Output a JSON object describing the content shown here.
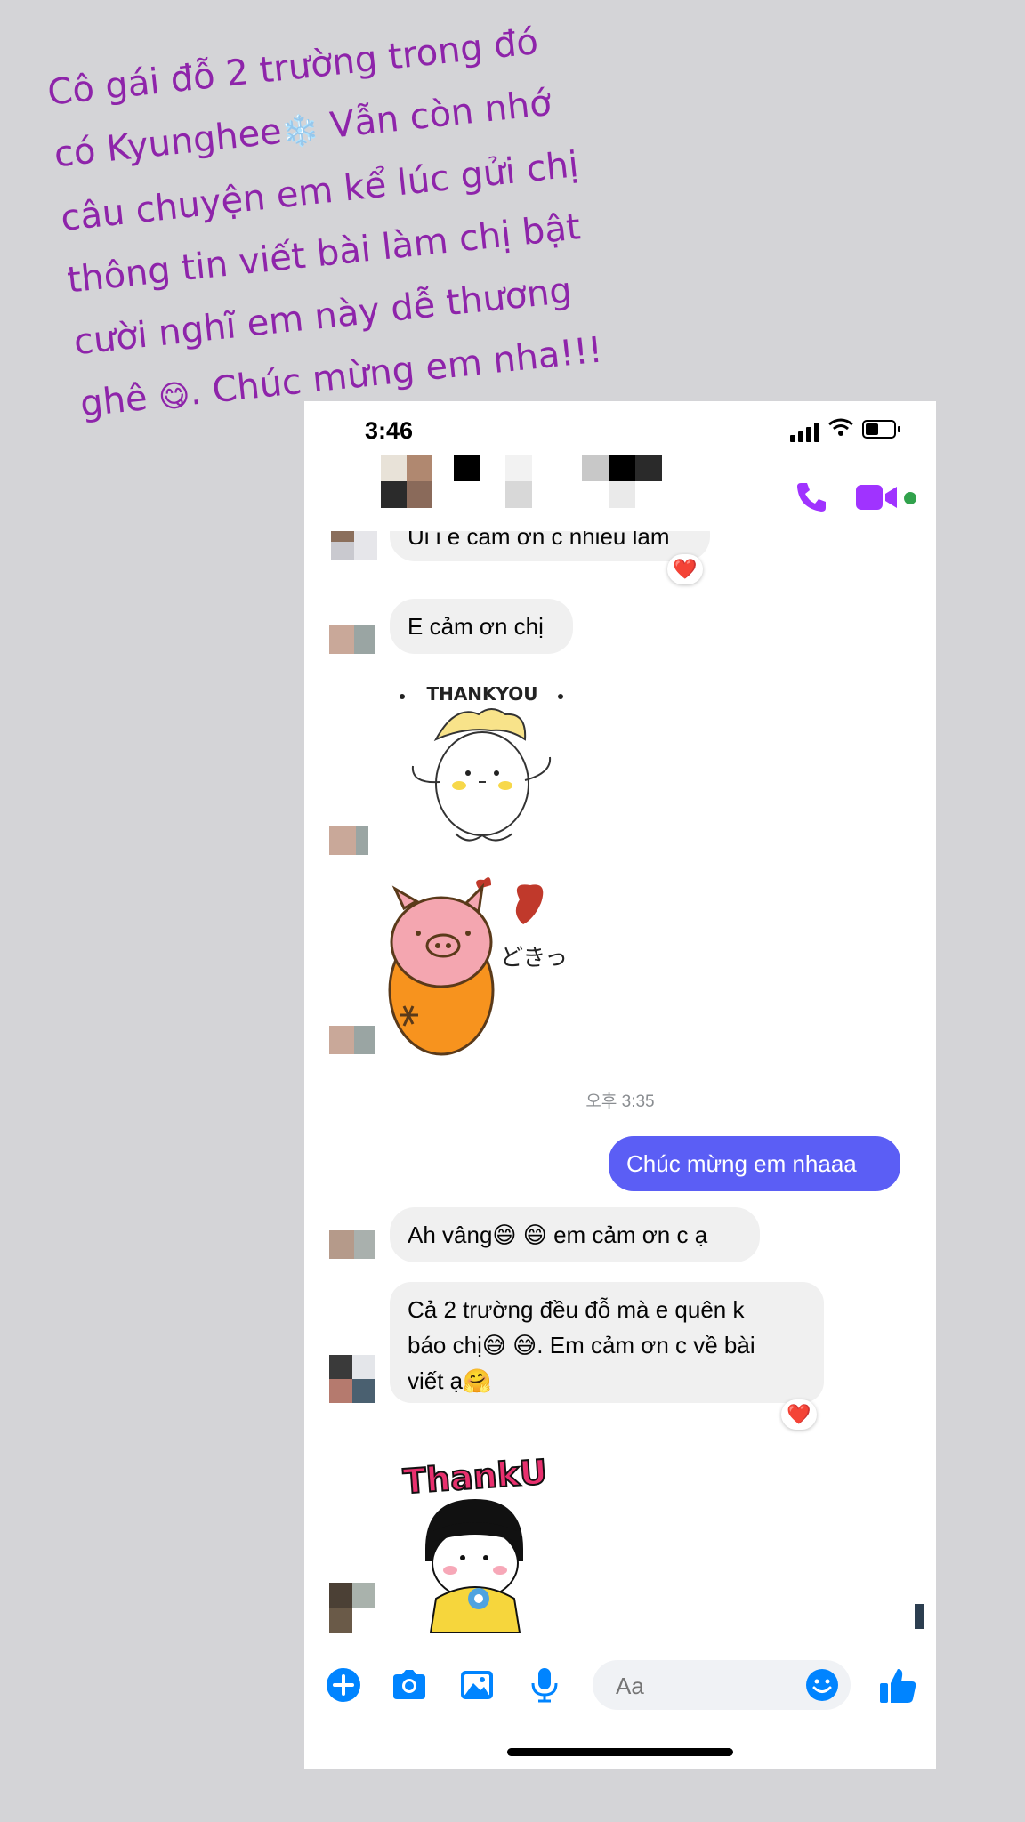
{
  "story": {
    "caption_lines": [
      "Cô gái đỗ 2 trường trong đó",
      "có Kyunghee",
      "❄️",
      " Vẫn còn nhớ",
      "câu chuyện em kể lúc gửi chị",
      "thông tin viết bài làm chị bật",
      "cười nghĩ  em này dễ thương",
      "ghê ",
      "😋",
      ". Chúc mừng em nha!!!"
    ],
    "accent_color": "#8e24aa"
  },
  "status_bar": {
    "time": "3:46",
    "icons": [
      "signal-icon",
      "wifi-icon",
      "battery-icon"
    ]
  },
  "header": {
    "contact_name_pixelated": true,
    "icons": [
      "phone-call-icon",
      "video-call-icon"
    ],
    "active_status_color": "#31a24c"
  },
  "messages": {
    "partial_top": "Ui i e cảm ơn c nhiều lắm",
    "m1": "E cảm ơn chị",
    "thankyou_sticker_text": "THANKYOU",
    "pig_sticker_text": "どきっ",
    "timestamp": "오후 3:35",
    "outgoing": "Chúc mừng em nhaaa",
    "m2_a": "Ah vâng",
    "m2_emoji": "😄 😄",
    "m2_b": " em cảm ơn c ạ",
    "m3_line1": "Cả 2 trường đều đỗ mà e quên k",
    "m3_line2a": "báo chị",
    "m3_line2_emoji": "😅 😅",
    "m3_line2b": ". Em cảm ơn c về bài",
    "m3_line3a": "viết ạ",
    "m3_line3_emoji": "🤗",
    "reaction": "❤️",
    "thanku_sticker_text": "ThankU"
  },
  "composer": {
    "placeholder": "Aa",
    "icons": [
      "add-icon",
      "camera-icon",
      "gallery-icon",
      "microphone-icon",
      "emoji-icon",
      "thumbs-up-icon"
    ],
    "accent_color": "#0084ff"
  },
  "colors": {
    "outgoing_bubble": "#5b5ef5",
    "incoming_bubble": "#f0f0f0",
    "messenger_purple": "#a033ff"
  }
}
